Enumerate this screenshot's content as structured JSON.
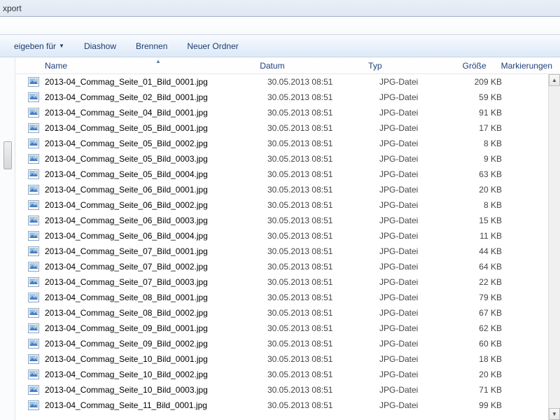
{
  "titlebar": {
    "text": "xport"
  },
  "toolbar": {
    "share_label": "eigeben für",
    "slideshow_label": "Diashow",
    "burn_label": "Brennen",
    "newfolder_label": "Neuer Ordner"
  },
  "columns": {
    "name": "Name",
    "date": "Datum",
    "type": "Typ",
    "size": "Größe",
    "tags": "Markierungen"
  },
  "files": [
    {
      "name": "2013-04_Commag_Seite_01_Bild_0001.jpg",
      "date": "30.05.2013 08:51",
      "type": "JPG-Datei",
      "size": "209 KB"
    },
    {
      "name": "2013-04_Commag_Seite_02_Bild_0001.jpg",
      "date": "30.05.2013 08:51",
      "type": "JPG-Datei",
      "size": "59 KB"
    },
    {
      "name": "2013-04_Commag_Seite_04_Bild_0001.jpg",
      "date": "30.05.2013 08:51",
      "type": "JPG-Datei",
      "size": "91 KB"
    },
    {
      "name": "2013-04_Commag_Seite_05_Bild_0001.jpg",
      "date": "30.05.2013 08:51",
      "type": "JPG-Datei",
      "size": "17 KB"
    },
    {
      "name": "2013-04_Commag_Seite_05_Bild_0002.jpg",
      "date": "30.05.2013 08:51",
      "type": "JPG-Datei",
      "size": "8 KB"
    },
    {
      "name": "2013-04_Commag_Seite_05_Bild_0003.jpg",
      "date": "30.05.2013 08:51",
      "type": "JPG-Datei",
      "size": "9 KB"
    },
    {
      "name": "2013-04_Commag_Seite_05_Bild_0004.jpg",
      "date": "30.05.2013 08:51",
      "type": "JPG-Datei",
      "size": "63 KB"
    },
    {
      "name": "2013-04_Commag_Seite_06_Bild_0001.jpg",
      "date": "30.05.2013 08:51",
      "type": "JPG-Datei",
      "size": "20 KB"
    },
    {
      "name": "2013-04_Commag_Seite_06_Bild_0002.jpg",
      "date": "30.05.2013 08:51",
      "type": "JPG-Datei",
      "size": "8 KB"
    },
    {
      "name": "2013-04_Commag_Seite_06_Bild_0003.jpg",
      "date": "30.05.2013 08:51",
      "type": "JPG-Datei",
      "size": "15 KB"
    },
    {
      "name": "2013-04_Commag_Seite_06_Bild_0004.jpg",
      "date": "30.05.2013 08:51",
      "type": "JPG-Datei",
      "size": "11 KB"
    },
    {
      "name": "2013-04_Commag_Seite_07_Bild_0001.jpg",
      "date": "30.05.2013 08:51",
      "type": "JPG-Datei",
      "size": "44 KB"
    },
    {
      "name": "2013-04_Commag_Seite_07_Bild_0002.jpg",
      "date": "30.05.2013 08:51",
      "type": "JPG-Datei",
      "size": "64 KB"
    },
    {
      "name": "2013-04_Commag_Seite_07_Bild_0003.jpg",
      "date": "30.05.2013 08:51",
      "type": "JPG-Datei",
      "size": "22 KB"
    },
    {
      "name": "2013-04_Commag_Seite_08_Bild_0001.jpg",
      "date": "30.05.2013 08:51",
      "type": "JPG-Datei",
      "size": "79 KB"
    },
    {
      "name": "2013-04_Commag_Seite_08_Bild_0002.jpg",
      "date": "30.05.2013 08:51",
      "type": "JPG-Datei",
      "size": "67 KB"
    },
    {
      "name": "2013-04_Commag_Seite_09_Bild_0001.jpg",
      "date": "30.05.2013 08:51",
      "type": "JPG-Datei",
      "size": "62 KB"
    },
    {
      "name": "2013-04_Commag_Seite_09_Bild_0002.jpg",
      "date": "30.05.2013 08:51",
      "type": "JPG-Datei",
      "size": "60 KB"
    },
    {
      "name": "2013-04_Commag_Seite_10_Bild_0001.jpg",
      "date": "30.05.2013 08:51",
      "type": "JPG-Datei",
      "size": "18 KB"
    },
    {
      "name": "2013-04_Commag_Seite_10_Bild_0002.jpg",
      "date": "30.05.2013 08:51",
      "type": "JPG-Datei",
      "size": "20 KB"
    },
    {
      "name": "2013-04_Commag_Seite_10_Bild_0003.jpg",
      "date": "30.05.2013 08:51",
      "type": "JPG-Datei",
      "size": "71 KB"
    },
    {
      "name": "2013-04_Commag_Seite_11_Bild_0001.jpg",
      "date": "30.05.2013 08:51",
      "type": "JPG-Datei",
      "size": "99 KB"
    }
  ]
}
